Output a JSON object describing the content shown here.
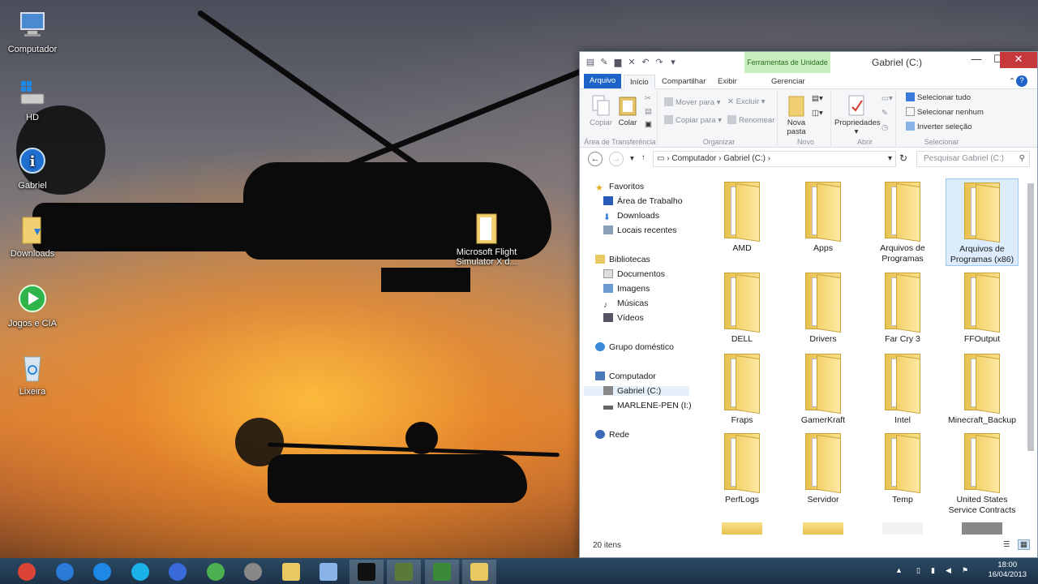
{
  "desktop": {
    "icons": [
      {
        "label": "Computador",
        "icon": "computer-icon"
      },
      {
        "label": "HD",
        "icon": "drive-icon"
      },
      {
        "label": "Gabriel",
        "icon": "info-icon"
      },
      {
        "label": "Downloads",
        "icon": "downloads-folder-icon"
      },
      {
        "label": "Jogos e CIA",
        "icon": "play-icon"
      },
      {
        "label": "Lixeira",
        "icon": "recycle-bin-icon"
      }
    ],
    "floating_folder": {
      "label": "Microsoft Flight Simulator X d...",
      "icon": "folder-icon"
    }
  },
  "window": {
    "title": "Gabriel (C:)",
    "context_tab": "Ferramentas de Unidade",
    "tabs": [
      "Arquivo",
      "Início",
      "Compartilhar",
      "Exibir",
      "Gerenciar"
    ],
    "ribbon": {
      "clipboard": {
        "copy": "Copiar",
        "paste": "Colar",
        "label": "Área de Transferência"
      },
      "organize": {
        "move_to": "Mover para",
        "copy_to": "Copiar para",
        "delete": "Excluir",
        "rename": "Renomear",
        "label": "Organizar"
      },
      "new": {
        "new_folder": "Nova pasta",
        "label": "Novo"
      },
      "open": {
        "properties": "Propriedades",
        "label": "Abrir"
      },
      "select": {
        "select_all": "Selecionar tudo",
        "select_none": "Selecionar nenhum",
        "invert": "Inverter seleção",
        "label": "Selecionar"
      }
    },
    "address": {
      "crumbs": [
        "Computador",
        "Gabriel (C:)"
      ]
    },
    "search_placeholder": "Pesquisar Gabriel (C:)",
    "nav": {
      "favorites": "Favoritos",
      "favorites_items": [
        "Área de Trabalho",
        "Downloads",
        "Locais recentes"
      ],
      "libraries": "Bibliotecas",
      "libraries_items": [
        "Documentos",
        "Imagens",
        "Músicas",
        "Vídeos"
      ],
      "homegroup": "Grupo doméstico",
      "computer": "Computador",
      "computer_items": [
        "Gabriel (C:)",
        "MARLENE-PEN (I:)"
      ],
      "network": "Rede"
    },
    "folders": [
      "AMD",
      "Apps",
      "Arquivos de Programas",
      "Arquivos de Programas (x86)",
      "DELL",
      "Drivers",
      "Far Cry 3",
      "FFOutput",
      "Fraps",
      "GamerKraft",
      "Intel",
      "Minecraft_Backup",
      "PerfLogs",
      "Servidor",
      "Temp",
      "United States Service Contracts"
    ],
    "status": "20 itens"
  },
  "taskbar": {
    "apps": [
      "chrome-icon",
      "itunes-icon",
      "network-icon",
      "skype-icon",
      "lightning-icon",
      "utorrent-icon",
      "media-icon",
      "iso-icon",
      "notes-icon",
      "terminal-icon",
      "game-icon",
      "game-record-icon",
      "explorer-icon"
    ],
    "time": "18:00",
    "date": "16/04/2013"
  }
}
